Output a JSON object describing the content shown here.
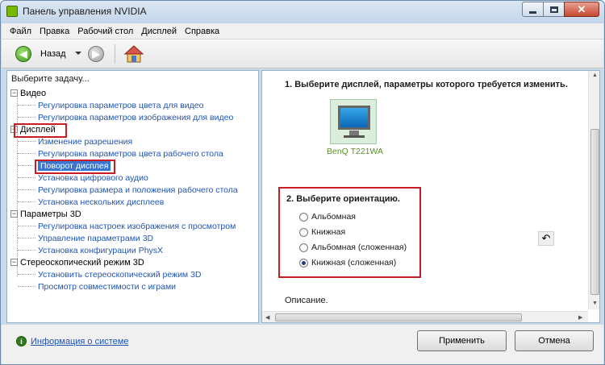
{
  "window": {
    "title": "Панель управления NVIDIA"
  },
  "menu": [
    "Файл",
    "Правка",
    "Рабочий стол",
    "Дисплей",
    "Справка"
  ],
  "toolbar": {
    "back_label": "Назад"
  },
  "left": {
    "header": "Выберите задачу...",
    "categories": [
      {
        "label": "Видео",
        "items": [
          "Регулировка параметров цвета для видео",
          "Регулировка параметров изображения для видео"
        ]
      },
      {
        "label": "Дисплей",
        "items": [
          "Изменение разрешения",
          "Регулировка параметров цвета рабочего стола",
          "Поворот дисплея",
          "Установка цифрового аудио",
          "Регулировка размера и положения рабочего стола",
          "Установка нескольких дисплеев"
        ]
      },
      {
        "label": "Параметры 3D",
        "items": [
          "Регулировка настроек изображения с просмотром",
          "Управление параметрами 3D",
          "Установка конфигурации PhysX"
        ]
      },
      {
        "label": "Стереоскопический режим 3D",
        "items": [
          "Установить стереоскопический режим 3D",
          "Просмотр совместимости с играми"
        ]
      }
    ],
    "selected_item": "Поворот дисплея"
  },
  "right": {
    "step1": "1. Выберите дисплей, параметры которого требуется изменить.",
    "monitor_label": "BenQ T221WA",
    "step2": "2. Выберите ориентацию.",
    "orientations": [
      "Альбомная",
      "Книжная",
      "Альбомная (сложенная)",
      "Книжная (сложенная)"
    ],
    "selected_orientation": "Книжная (сложенная)",
    "description_label": "Описание."
  },
  "footer": {
    "sysinfo_link": "Информация о системе",
    "apply_button": "Применить",
    "cancel_button": "Отмена"
  },
  "colors": {
    "nvidia_green": "#76b900",
    "link_blue": "#1f54b3",
    "highlight_red": "#c81d25",
    "selection_blue": "#3a76d0"
  },
  "icons": {
    "back": "arrow-left-icon",
    "forward": "arrow-right-icon",
    "home": "home-icon",
    "rotate": "rotate-icon",
    "sysinfo": "nvidia-info-icon"
  }
}
